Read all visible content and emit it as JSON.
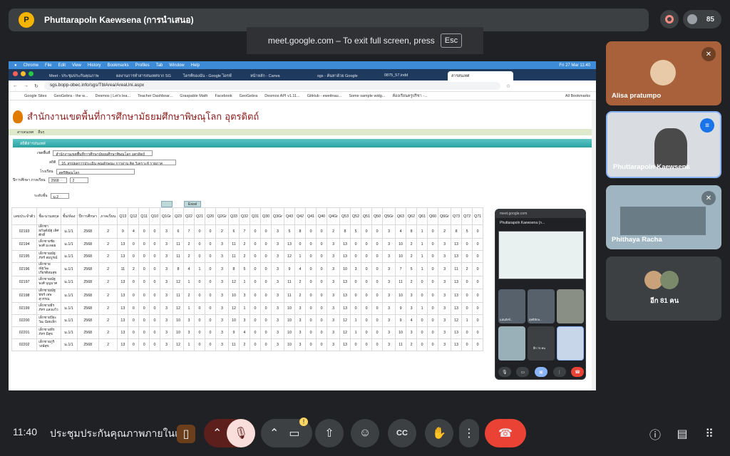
{
  "presenter": {
    "name": "Phuttarapoln Kaewsena (การนำเสนอ)",
    "initial": "P"
  },
  "participant_count": "85",
  "toast": {
    "text": "meet.google.com – To exit full screen, press",
    "key": "Esc"
  },
  "mac_menu": [
    "Chrome",
    "File",
    "Edit",
    "View",
    "History",
    "Bookmarks",
    "Profiles",
    "Tab",
    "Window",
    "Help"
  ],
  "mac_status": "Fri 27 Mar 11:40",
  "browser_tabs": [
    {
      "label": "Meet - ประชุมประกันคุณภาพ",
      "active": false
    },
    {
      "label": "ผลงานการทำสารสนเทศจาก SG",
      "active": false
    },
    {
      "label": "ไดรฟ์ของฉัน - Google ไดรฟ์",
      "active": false
    },
    {
      "label": "หน้าหลัก - Canva",
      "active": false
    },
    {
      "label": "sgs - ค้นหาด้วย Google",
      "active": false
    },
    {
      "label": "0875_57.indd",
      "active": false
    },
    {
      "label": "สารสนเทศ",
      "active": true
    }
  ],
  "url": "sgs.bopp-obec.info/sgs/TblArea/AreaUni.aspx",
  "bookmarks": [
    "Google Sites",
    "GeoGebra - the w...",
    "Desmos | Let's lea...",
    "Teacher Dashboar...",
    "Graspable Math",
    "Facebook",
    "GeoGebra",
    "Desmos API v1.11...",
    "GitHub - eweitnau...",
    "Some sample widg...",
    "ห้องเรียนครูปริชา -..."
  ],
  "all_bookmarks": "All Bookmarks",
  "site": {
    "title": "สำนักงานเขตพื้นที่การศึกษามัธยมศึกษาพิษณุโลก อุตรดิตถ์",
    "menu": [
      "สารสนเทศ",
      "อื่นๆ"
    ],
    "section": "สถิติสารสนเทศ",
    "filters": {
      "area_label": "เขตพื้นที่",
      "area_value": "สำนักงานเขตพื้นที่การศึกษามัธยมศึกษาพิษณุโลก อุตรดิตถ์",
      "stat_label": "สถิติ",
      "stat_value": "16. สรุปผลการประเมิน คุณลักษณะ การอ่าน คิด วิเคราะห์ รายภาค",
      "school_label": "โรงเรียน",
      "school_value": "สตรีพิษณุโลก",
      "year_label": "ปีการศึกษา ภาคเรียน",
      "year_value": "2568",
      "term_value": "2",
      "level_label": "ระดับชั้น",
      "level_value": "ม.2"
    },
    "buttons": [
      "",
      "Excel"
    ]
  },
  "table": {
    "headers": [
      "เลขประจำตัว",
      "ชื่อ-นามสกุล",
      "ชั้น/ห้อง",
      "ปีการศึกษา",
      "ภาคเรียน",
      "Q13",
      "Q12",
      "Q11",
      "Q10",
      "Q1Gr",
      "Q23",
      "Q22",
      "Q21",
      "Q20",
      "Q2Gr",
      "Q33",
      "Q32",
      "Q31",
      "Q30",
      "Q3Gr",
      "Q43",
      "Q42",
      "Q41",
      "Q40",
      "Q4Gr",
      "Q53",
      "Q52",
      "Q51",
      "Q50",
      "Q5Gr",
      "Q63",
      "Q62",
      "Q61",
      "Q60",
      "Q6Gr",
      "Q73",
      "Q72",
      "Q71",
      "Q70",
      "Q7Gr",
      "Q83",
      "Q82",
      "Q81",
      "Q80",
      "Q8Gr",
      "Q93",
      "Q92",
      "Q91",
      "Q90",
      "Q9Gr"
    ],
    "rows": [
      {
        "id": "02193",
        "name": "เด็กชายกันต์ณัฐ เลิศศักดิ์",
        "room": "ม.1/1",
        "year": "2568",
        "term": "2",
        "v": [
          "9",
          "4",
          "0",
          "0",
          "3",
          "6",
          "7",
          "0",
          "0",
          "2",
          "6",
          "7",
          "0",
          "0",
          "3",
          "5",
          "8",
          "0",
          "0",
          "2",
          "8",
          "5",
          "0",
          "0",
          "3",
          "4",
          "8",
          "1",
          "0",
          "2",
          "8",
          "5",
          "0",
          "0",
          "3",
          "8",
          "4",
          "1",
          "0",
          "3",
          "0",
          "0",
          "0",
          "0",
          "0"
        ]
      },
      {
        "id": "02194",
        "name": "เด็กชายชัยพงศ์ มะลอย",
        "room": "ม.1/1",
        "year": "2568",
        "term": "2",
        "v": [
          "13",
          "0",
          "0",
          "0",
          "3",
          "11",
          "2",
          "0",
          "0",
          "3",
          "11",
          "2",
          "0",
          "0",
          "3",
          "13",
          "0",
          "0",
          "0",
          "3",
          "13",
          "0",
          "0",
          "0",
          "3",
          "10",
          "2",
          "1",
          "0",
          "3",
          "13",
          "0",
          "0",
          "0",
          "3",
          "13",
          "0",
          "0",
          "0",
          "3",
          "0",
          "0",
          "0",
          "0",
          "0"
        ]
      },
      {
        "id": "02195",
        "name": "เด็กชายณัฐภัทร์ สมบูรณ์",
        "room": "ม.1/1",
        "year": "2568",
        "term": "2",
        "v": [
          "13",
          "0",
          "0",
          "0",
          "3",
          "11",
          "2",
          "0",
          "0",
          "3",
          "11",
          "2",
          "0",
          "0",
          "3",
          "12",
          "1",
          "0",
          "0",
          "3",
          "13",
          "0",
          "0",
          "0",
          "3",
          "10",
          "2",
          "1",
          "0",
          "3",
          "13",
          "0",
          "0",
          "0",
          "3",
          "12",
          "1",
          "0",
          "0",
          "3",
          "0",
          "0",
          "0",
          "0",
          "0"
        ]
      },
      {
        "id": "02196",
        "name": "เด็กชายณัฐวัฒ เกียรติสมสุข",
        "room": "ม.1/1",
        "year": "2568",
        "term": "2",
        "v": [
          "11",
          "2",
          "0",
          "0",
          "3",
          "8",
          "4",
          "1",
          "0",
          "3",
          "8",
          "5",
          "0",
          "0",
          "3",
          "9",
          "4",
          "0",
          "0",
          "3",
          "10",
          "3",
          "0",
          "0",
          "3",
          "7",
          "5",
          "1",
          "0",
          "3",
          "11",
          "2",
          "0",
          "0",
          "3",
          "10",
          "3",
          "0",
          "0",
          "3",
          "0",
          "0",
          "0",
          "0",
          "0"
        ]
      },
      {
        "id": "02197",
        "name": "เด็กชายณัฐพงศ์ บุญมาศ",
        "room": "ม.1/1",
        "year": "2568",
        "term": "2",
        "v": [
          "13",
          "0",
          "0",
          "0",
          "3",
          "12",
          "1",
          "0",
          "0",
          "3",
          "12",
          "1",
          "0",
          "0",
          "3",
          "11",
          "2",
          "0",
          "0",
          "3",
          "13",
          "0",
          "0",
          "0",
          "3",
          "11",
          "2",
          "0",
          "0",
          "3",
          "13",
          "0",
          "0",
          "0",
          "3",
          "13",
          "0",
          "0",
          "0",
          "3",
          "0",
          "0",
          "0",
          "0",
          "0"
        ]
      },
      {
        "id": "02198",
        "name": "เด็กชายณัฐพัชร์ เทพสุวรรณ",
        "room": "ม.1/1",
        "year": "2568",
        "term": "2",
        "v": [
          "13",
          "0",
          "0",
          "0",
          "3",
          "11",
          "2",
          "0",
          "0",
          "3",
          "10",
          "3",
          "0",
          "0",
          "3",
          "11",
          "2",
          "0",
          "0",
          "3",
          "13",
          "0",
          "0",
          "0",
          "3",
          "10",
          "3",
          "0",
          "0",
          "3",
          "13",
          "0",
          "0",
          "0",
          "3",
          "12",
          "1",
          "0",
          "0",
          "3",
          "0",
          "0",
          "0",
          "0",
          "0"
        ]
      },
      {
        "id": "02199",
        "name": "เด็กชายธีรภัทร แสงแก้ว",
        "room": "ม.1/1",
        "year": "2568",
        "term": "2",
        "v": [
          "13",
          "0",
          "0",
          "0",
          "3",
          "12",
          "1",
          "0",
          "0",
          "3",
          "12",
          "1",
          "0",
          "0",
          "3",
          "10",
          "3",
          "0",
          "0",
          "3",
          "13",
          "0",
          "0",
          "0",
          "3",
          "9",
          "3",
          "1",
          "0",
          "3",
          "13",
          "0",
          "0",
          "0",
          "3",
          "13",
          "0",
          "0",
          "0",
          "3",
          "0",
          "0",
          "0",
          "0",
          "0"
        ]
      },
      {
        "id": "02200",
        "name": "เด็กชายปิยะวัฒ น้อยเล็ก",
        "room": "ม.1/1",
        "year": "2568",
        "term": "2",
        "v": [
          "13",
          "0",
          "0",
          "0",
          "3",
          "10",
          "3",
          "0",
          "0",
          "3",
          "10",
          "3",
          "0",
          "0",
          "3",
          "10",
          "3",
          "0",
          "0",
          "3",
          "12",
          "1",
          "0",
          "0",
          "3",
          "9",
          "4",
          "0",
          "0",
          "3",
          "12",
          "1",
          "0",
          "0",
          "3",
          "12",
          "1",
          "0",
          "0",
          "3",
          "0",
          "0",
          "0",
          "0",
          "0"
        ]
      },
      {
        "id": "02201",
        "name": "เด็กชายพีรภัทร มีสุข",
        "room": "ม.1/1",
        "year": "2568",
        "term": "2",
        "v": [
          "13",
          "0",
          "0",
          "0",
          "3",
          "10",
          "3",
          "0",
          "0",
          "3",
          "9",
          "4",
          "0",
          "0",
          "3",
          "10",
          "3",
          "0",
          "0",
          "3",
          "12",
          "1",
          "0",
          "0",
          "3",
          "10",
          "3",
          "0",
          "0",
          "3",
          "13",
          "0",
          "0",
          "0",
          "3",
          "12",
          "1",
          "0",
          "0",
          "3",
          "0",
          "0",
          "0",
          "0",
          "0"
        ]
      },
      {
        "id": "02202",
        "name": "เด็กชายภูริ วงษ์สุข",
        "room": "ม.1/1",
        "year": "2568",
        "term": "2",
        "v": [
          "13",
          "0",
          "0",
          "0",
          "3",
          "12",
          "1",
          "0",
          "0",
          "3",
          "11",
          "2",
          "0",
          "0",
          "3",
          "10",
          "3",
          "0",
          "0",
          "3",
          "13",
          "0",
          "0",
          "0",
          "3",
          "11",
          "2",
          "0",
          "0",
          "3",
          "13",
          "0",
          "0",
          "0",
          "3",
          "12",
          "1",
          "0",
          "0",
          "3",
          "0",
          "0",
          "0",
          "0",
          "0"
        ]
      }
    ]
  },
  "pip": {
    "url": "meet.google.com",
    "presenter": "Phuttarapoln Kaewsena (ก...",
    "tiles": [
      "แอ่นสังข์...",
      "สุทธิลักษ...",
      "",
      "",
      "อีก 79 คน",
      ""
    ]
  },
  "tiles": [
    {
      "name": "Alisa pratumpo",
      "muted": true
    },
    {
      "name": "Phuttarapoln Kaewsena",
      "muted": false
    },
    {
      "name": "Phithaya Racha",
      "muted": true
    },
    {
      "name": "อีก 81 คน",
      "muted": false
    }
  ],
  "bottom": {
    "time": "11:40",
    "meeting": "ประชุมประกันคุณภาพภายในและ..."
  },
  "colors": {
    "end_call": "#ea4335",
    "mic_off": "#f28b82",
    "bg": "#202124"
  }
}
